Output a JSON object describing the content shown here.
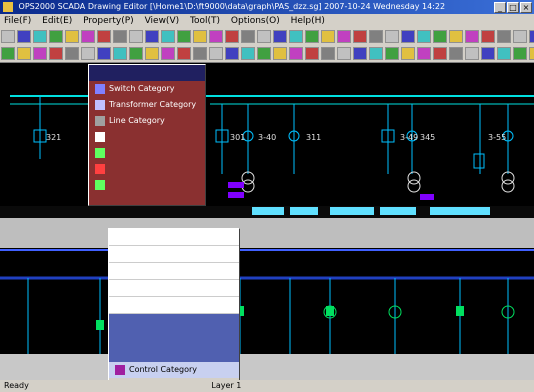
{
  "window": {
    "title": "OPS2000 SCADA Drawing Editor [\\Home1\\D:\\ft9000\\data\\graph\\PAS_dzz.sg] 2007-10-24 Wednesday 14:22"
  },
  "menus": [
    "File(F)",
    "Edit(E)",
    "Property(P)",
    "View(V)",
    "Tool(T)",
    "Options(O)",
    "Help(H)"
  ],
  "feeder_labels": [
    "321",
    "301",
    "3-40",
    "311",
    "3-49",
    "345",
    "3-55"
  ],
  "category_panel": {
    "items": [
      "Switch Category",
      "Transformer Category",
      "Line Category",
      "Control Category"
    ]
  },
  "colors": {
    "busbar": "#00e0e0",
    "breaker": "#00c0ff",
    "measure": "#8000ff",
    "panel_bg": "#d4d0c8",
    "title_bg": "#0a2a8c"
  },
  "statusbar": {
    "left": "Ready",
    "mid": "Layer 1"
  }
}
